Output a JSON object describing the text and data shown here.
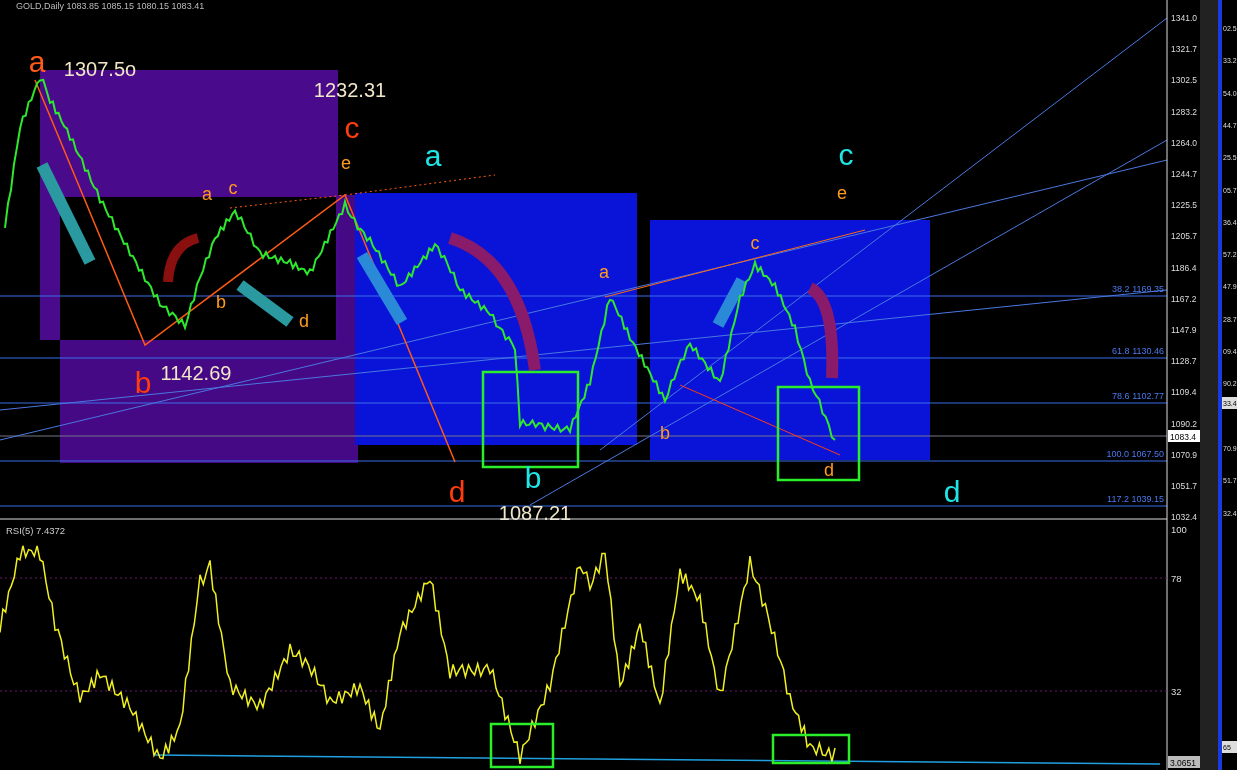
{
  "header": {
    "symbol": "GOLD,Daily",
    "ohlc": "1083.85 1085.15 1080.15 1083.41"
  },
  "price_axis": {
    "labels": [
      "1341.0",
      "1321.7",
      "1302.5",
      "1283.2",
      "1264.0",
      "1244.7",
      "1225.5",
      "1205.7",
      "1186.4",
      "1167.2",
      "1147.9",
      "1128.7",
      "1109.4",
      "1090.2",
      "1070.9",
      "1051.7",
      "1032.4"
    ],
    "current_price": "1083.4"
  },
  "fib_levels": [
    {
      "ratio": "38.2",
      "price": "1169.35"
    },
    {
      "ratio": "61.8",
      "price": "1130.46"
    },
    {
      "ratio": "78.6",
      "price": "1102.77"
    },
    {
      "ratio": "100.0",
      "price": "1067.50"
    },
    {
      "ratio": "117.2",
      "price": "1039.15"
    }
  ],
  "annotations": [
    {
      "text": "a",
      "kind": "wave-large",
      "color": "#ff5a1e"
    },
    {
      "text": "1307.5o",
      "kind": "price",
      "color": "#f0e6c8"
    },
    {
      "text": "1232.31",
      "kind": "price",
      "color": "#f0e6c8"
    },
    {
      "text": "c",
      "kind": "wave-large",
      "color": "#ff3c0a"
    },
    {
      "text": "e",
      "kind": "wave-small",
      "color": "#ff9a1e"
    },
    {
      "text": "a",
      "kind": "wave-large",
      "color": "#1ee6e6"
    },
    {
      "text": "a",
      "kind": "wave-small",
      "color": "#ff9a1e"
    },
    {
      "text": "c",
      "kind": "wave-small",
      "color": "#ff9a1e"
    },
    {
      "text": "b",
      "kind": "wave-small",
      "color": "#ff9a1e"
    },
    {
      "text": "d",
      "kind": "wave-small",
      "color": "#ff9a1e"
    },
    {
      "text": "b",
      "kind": "wave-large",
      "color": "#ff3c0a"
    },
    {
      "text": "1142.69",
      "kind": "price",
      "color": "#f0e6c8"
    },
    {
      "text": "d",
      "kind": "wave-large",
      "color": "#ff3c0a"
    },
    {
      "text": "b",
      "kind": "wave-large",
      "color": "#1ee6e6"
    },
    {
      "text": "1087.21",
      "kind": "price",
      "color": "#f0e6c8"
    },
    {
      "text": "a",
      "kind": "wave-small",
      "color": "#ff9a1e"
    },
    {
      "text": "b",
      "kind": "wave-small",
      "color": "#ff9a1e"
    },
    {
      "text": "c",
      "kind": "wave-small",
      "color": "#ff9a1e"
    },
    {
      "text": "c",
      "kind": "wave-large",
      "color": "#1ee6e6"
    },
    {
      "text": "e",
      "kind": "wave-small",
      "color": "#ff9a1e"
    },
    {
      "text": "d",
      "kind": "wave-small",
      "color": "#ff9a1e"
    },
    {
      "text": "d",
      "kind": "wave-large",
      "color": "#1ee6e6"
    }
  ],
  "rsi": {
    "title": "RSI(5) 7.4372",
    "levels": [
      "100",
      "78",
      "32"
    ],
    "current_value": "3.0651"
  },
  "adjacent_chart_labels": [
    {
      "text": "02.5",
      "selected": false
    },
    {
      "text": "33.2",
      "selected": false
    },
    {
      "text": "54.0",
      "selected": false
    },
    {
      "text": "44.7",
      "selected": false
    },
    {
      "text": "25.5",
      "selected": false
    },
    {
      "text": "05.7",
      "selected": false
    },
    {
      "text": "36.4",
      "selected": false
    },
    {
      "text": "57.2",
      "selected": false
    },
    {
      "text": "47.9",
      "selected": false
    },
    {
      "text": "28.7",
      "selected": false
    },
    {
      "text": "09.4",
      "selected": false
    },
    {
      "text": "90.2",
      "selected": false
    },
    {
      "text": "33.4",
      "selected": true
    },
    {
      "text": "70.9",
      "selected": false
    },
    {
      "text": "51.7",
      "selected": false
    },
    {
      "text": "32.4",
      "selected": false
    },
    {
      "text": "65",
      "selected": true
    }
  ]
}
